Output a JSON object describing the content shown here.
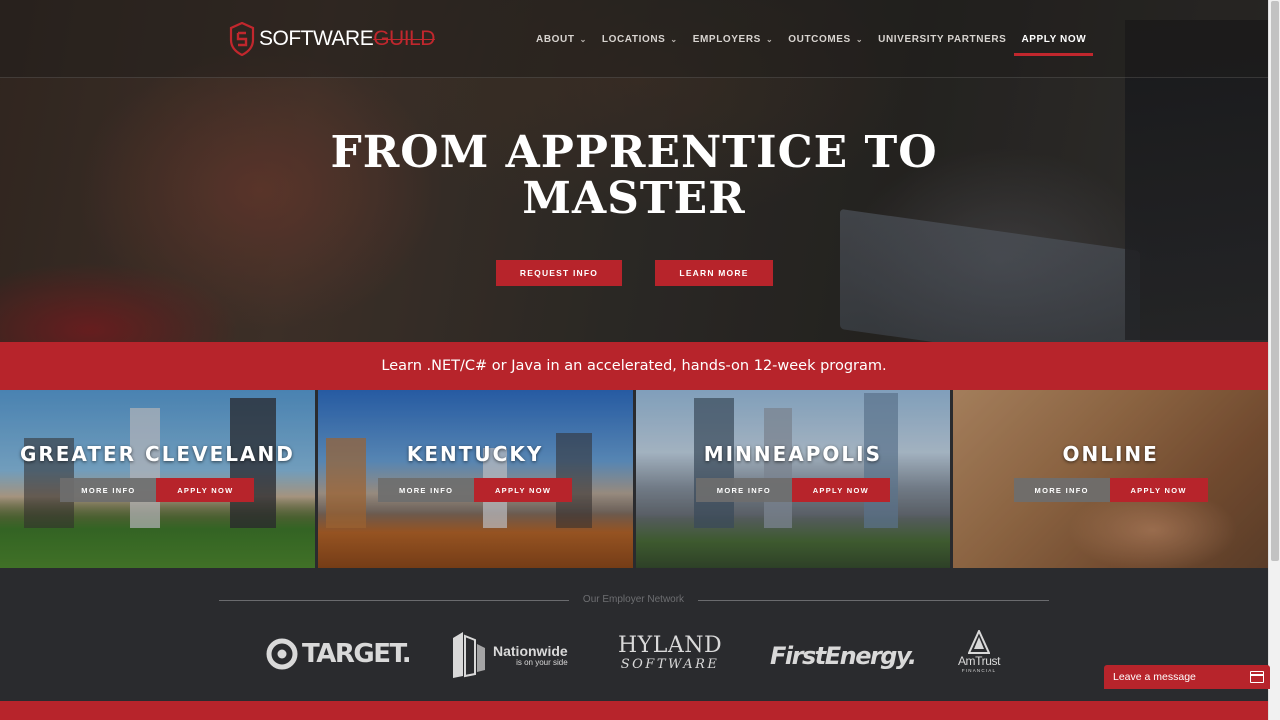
{
  "brand": {
    "logo_part1": "SOFTWARE",
    "logo_part2": "GUILD",
    "accent_color": "#b7242b"
  },
  "nav": {
    "items": [
      {
        "label": "ABOUT",
        "has_dropdown": true
      },
      {
        "label": "LOCATIONS",
        "has_dropdown": true
      },
      {
        "label": "EMPLOYERS",
        "has_dropdown": true
      },
      {
        "label": "OUTCOMES",
        "has_dropdown": true
      },
      {
        "label": "UNIVERSITY PARTNERS",
        "has_dropdown": false
      },
      {
        "label": "APPLY NOW",
        "has_dropdown": false,
        "active": true
      }
    ]
  },
  "hero": {
    "title_line1": "FROM APPRENTICE TO",
    "title_line2": "MASTER",
    "request_button": "REQUEST INFO",
    "learn_button": "LEARN MORE"
  },
  "banner": {
    "text": "Learn .NET/C# or Java in an accelerated, hands-on 12-week program."
  },
  "locations": [
    {
      "name": "GREATER CLEVELAND",
      "more": "MORE INFO",
      "apply": "APPLY NOW"
    },
    {
      "name": "KENTUCKY",
      "more": "MORE INFO",
      "apply": "APPLY NOW"
    },
    {
      "name": "MINNEAPOLIS",
      "more": "MORE INFO",
      "apply": "APPLY NOW"
    },
    {
      "name": "ONLINE",
      "more": "MORE INFO",
      "apply": "APPLY NOW"
    }
  ],
  "employers": {
    "heading": "Our Employer Network",
    "logos": {
      "target": "TARGET.",
      "nationwide": "Nationwide",
      "nationwide_tag": "is on your side",
      "hyland_1": "HYLAND",
      "hyland_2": "SOFTWARE",
      "firstenergy": "FirstEnergy.",
      "amtrust": "AmTrust",
      "amtrust_sub": "FINANCIAL"
    }
  },
  "chat": {
    "label": "Leave a message"
  }
}
